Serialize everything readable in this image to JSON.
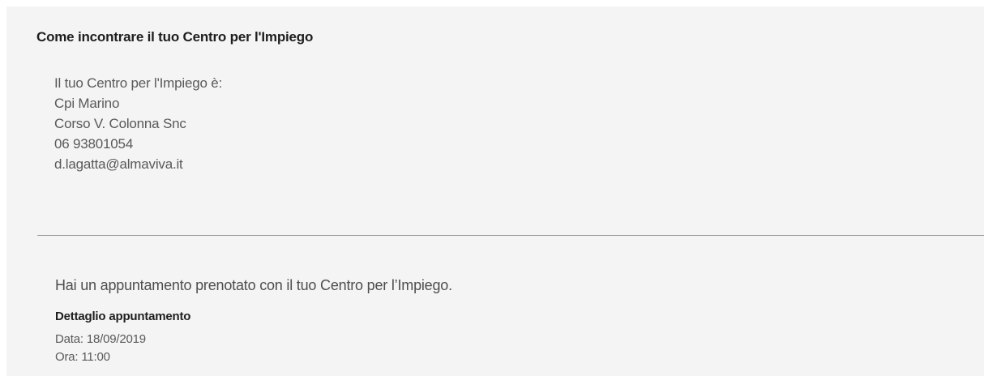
{
  "section": {
    "title": "Come incontrare il tuo Centro per l'Impiego"
  },
  "cpi": {
    "intro": "Il tuo Centro per l'Impiego è:",
    "name": "Cpi Marino",
    "address": "Corso V. Colonna Snc",
    "phone": "06 93801054",
    "email": "d.lagatta@almaviva.it"
  },
  "appointment": {
    "notice": "Hai un appuntamento prenotato con il tuo Centro per l’Impiego.",
    "detail_title": "Dettaglio appuntamento",
    "date_label": "Data: 18/09/2019",
    "time_label": "Ora: 11:00"
  }
}
